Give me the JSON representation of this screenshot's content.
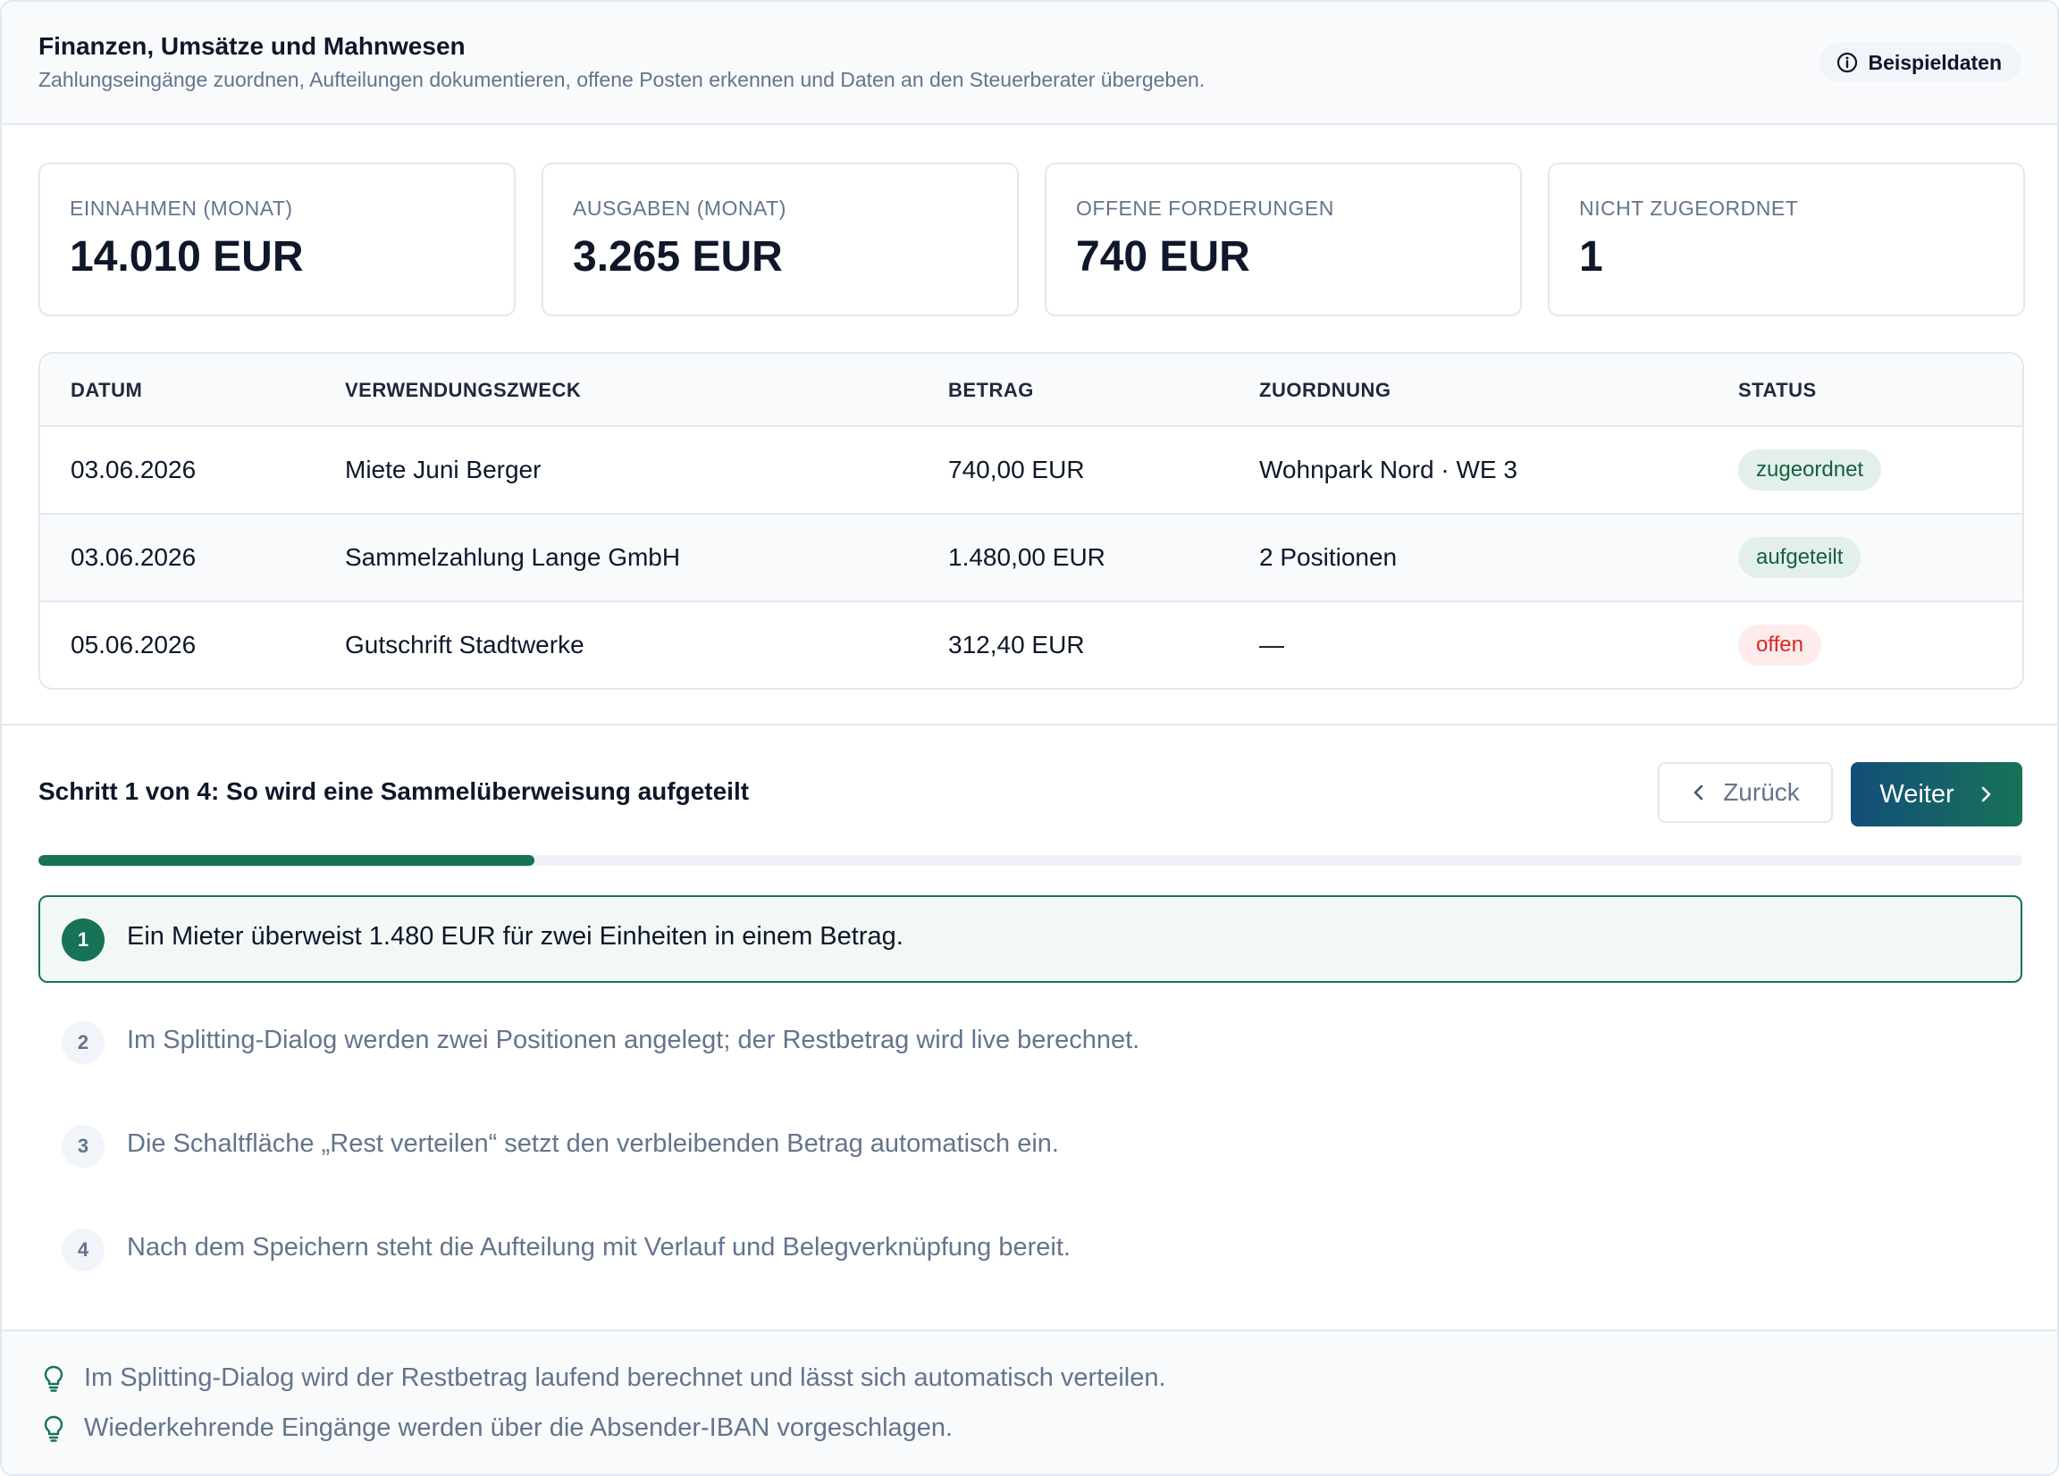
{
  "header": {
    "title": "Finanzen, Umsätze und Mahnwesen",
    "subtitle": "Zahlungseingänge zuordnen, Aufteilungen dokumentieren, offene Posten erkennen und Daten an den Steuerberater übergeben.",
    "badge": "Beispieldaten",
    "badge_icon": "info-icon"
  },
  "kpis": [
    {
      "label": "EINNAHMEN (MONAT)",
      "value": "14.010 EUR"
    },
    {
      "label": "AUSGABEN (MONAT)",
      "value": "3.265 EUR"
    },
    {
      "label": "OFFENE FORDERUNGEN",
      "value": "740 EUR"
    },
    {
      "label": "NICHT ZUGEORDNET",
      "value": "1"
    }
  ],
  "table": {
    "columns": [
      "DATUM",
      "VERWENDUNGSZWECK",
      "BETRAG",
      "ZUORDNUNG",
      "STATUS"
    ],
    "rows": [
      {
        "date": "03.06.2026",
        "purpose": "Miete Juni Berger",
        "amount": "740,00 EUR",
        "assignment": "Wohnpark Nord · WE 3",
        "status": "zugeordnet"
      },
      {
        "date": "03.06.2026",
        "purpose": "Sammelzahlung Lange GmbH",
        "amount": "1.480,00 EUR",
        "assignment": "2 Positionen",
        "status": "aufgeteilt"
      },
      {
        "date": "05.06.2026",
        "purpose": "Gutschrift Stadtwerke",
        "amount": "312,40 EUR",
        "assignment": "—",
        "status": "offen"
      }
    ],
    "status_colors": {
      "zugeordnet": "#166044",
      "aufgeteilt": "#166044",
      "offen": "#dc2626"
    }
  },
  "stepper": {
    "title": "Schritt 1 von 4: So wird eine Sammelüberweisung aufgeteilt",
    "back_label": "Zurück",
    "next_label": "Weiter",
    "progress": 0.25,
    "accent": "#177257",
    "steps": [
      {
        "num": "1",
        "text": "Ein Mieter überweist 1.480 EUR für zwei Einheiten in einem Betrag."
      },
      {
        "num": "2",
        "text": "Im Splitting-Dialog werden zwei Positionen angelegt; der Restbetrag wird live berechnet."
      },
      {
        "num": "3",
        "text": "Die Schaltfläche „Rest verteilen“ setzt den verbleibenden Betrag automatisch ein."
      },
      {
        "num": "4",
        "text": "Nach dem Speichern steht die Aufteilung mit Verlauf und Belegverknüpfung bereit."
      }
    ],
    "active_step": 1
  },
  "hints": [
    {
      "icon": "lightbulb-icon",
      "text": "Im Splitting-Dialog wird der Restbetrag laufend berechnet und lässt sich automatisch verteilen."
    },
    {
      "icon": "lightbulb-icon",
      "text": "Wiederkehrende Eingänge werden über die Absender-IBAN vorgeschlagen."
    }
  ]
}
